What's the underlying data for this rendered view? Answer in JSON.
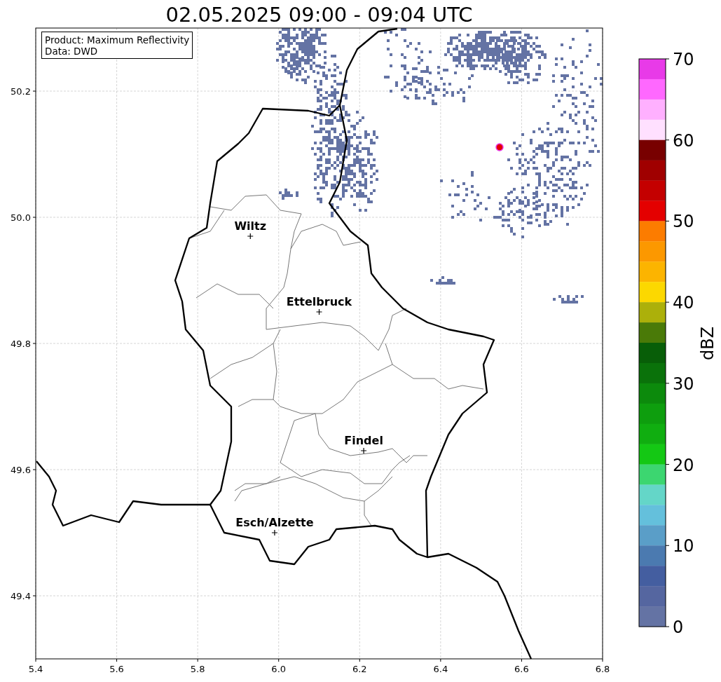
{
  "title": "02.05.2025 09:00 - 09:04 UTC",
  "info_box": {
    "lines": [
      "Product: Maximum Reflectivity",
      "Data: DWD"
    ]
  },
  "map": {
    "x_ticks": [
      "5.4",
      "5.6",
      "5.8",
      "6.0",
      "6.2",
      "6.4",
      "6.6",
      "6.8"
    ],
    "y_ticks": [
      "50.2",
      "50.0",
      "49.8",
      "49.6",
      "49.4"
    ],
    "cities": [
      {
        "name": "Wiltz"
      },
      {
        "name": "Ettelbruck"
      },
      {
        "name": "Findel"
      },
      {
        "name": "Esch/Alzette"
      }
    ]
  },
  "colorbar": {
    "label": "dBZ",
    "ticks": [
      "70",
      "60",
      "50",
      "40",
      "30",
      "20",
      "10",
      "0"
    ],
    "steps": [
      {
        "color": "#e83ae8"
      },
      {
        "color": "#ff68ff"
      },
      {
        "color": "#ffb0ff"
      },
      {
        "color": "#ffe0ff"
      },
      {
        "color": "#780000"
      },
      {
        "color": "#a00000"
      },
      {
        "color": "#c40000"
      },
      {
        "color": "#e40000"
      },
      {
        "color": "#fc7c00"
      },
      {
        "color": "#fc9800"
      },
      {
        "color": "#fcb400"
      },
      {
        "color": "#fcd800"
      },
      {
        "color": "#acb00a"
      },
      {
        "color": "#4a7a08"
      },
      {
        "color": "#085e08"
      },
      {
        "color": "#0a720a"
      },
      {
        "color": "#0c8a0c"
      },
      {
        "color": "#0e9e0e"
      },
      {
        "color": "#10ae10"
      },
      {
        "color": "#14c814"
      },
      {
        "color": "#3cd670"
      },
      {
        "color": "#64d6c8"
      },
      {
        "color": "#64c0dc"
      },
      {
        "color": "#5a9ec8"
      },
      {
        "color": "#4b7ab0"
      },
      {
        "color": "#445ea0"
      },
      {
        "color": "#5566a0"
      },
      {
        "color": "#6473a4"
      }
    ]
  }
}
